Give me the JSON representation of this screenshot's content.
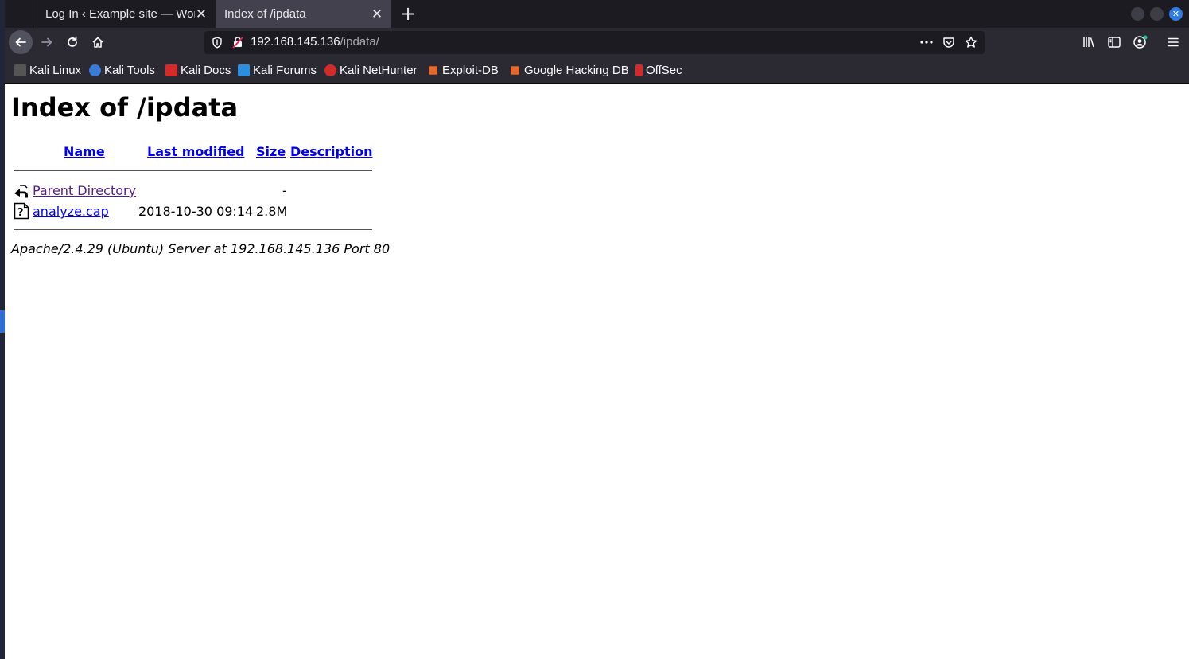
{
  "tabs": [
    {
      "label": "Log In ‹ Example site — WordPress",
      "close": "✕"
    },
    {
      "label": "Index of /ipdata",
      "close": "✕"
    }
  ],
  "new_tab": "+",
  "window_controls": {
    "close": "✕"
  },
  "url": {
    "host": "192.168.145.136",
    "path": "/ipdata/"
  },
  "bookmarks": [
    {
      "label": "Kali Linux",
      "icon": "kali-dragon-icon",
      "color": "#555555"
    },
    {
      "label": "Kali Tools",
      "icon": "kali-tools-icon",
      "color": "#3a7bd5"
    },
    {
      "label": "Kali Docs",
      "icon": "kali-docs-icon",
      "color": "#d42a2a"
    },
    {
      "label": "Kali Forums",
      "icon": "kali-forums-icon",
      "color": "#2d8ee0"
    },
    {
      "label": "Kali NetHunter",
      "icon": "nethunter-icon",
      "color": "#d42a2a"
    },
    {
      "label": "Exploit-DB",
      "icon": "exploit-db-icon",
      "color": "#e8672a"
    },
    {
      "label": "Google Hacking DB",
      "icon": "ghdb-icon",
      "color": "#e8672a"
    },
    {
      "label": "OffSec",
      "icon": "offsec-icon",
      "color": "#d42a2a"
    }
  ],
  "page": {
    "title": "Index of /ipdata",
    "columns": {
      "name": "Name",
      "modified": "Last modified",
      "size": "Size",
      "description": "Description"
    },
    "rows": [
      {
        "name": "Parent Directory",
        "modified": "",
        "size": "-",
        "icon": "back-arrow-icon"
      },
      {
        "name": "analyze.cap",
        "modified": "2018-10-30 09:14",
        "size": "2.8M",
        "icon": "unknown-file-icon"
      }
    ],
    "address": "Apache/2.4.29 (Ubuntu) Server at 192.168.145.136 Port 80"
  }
}
